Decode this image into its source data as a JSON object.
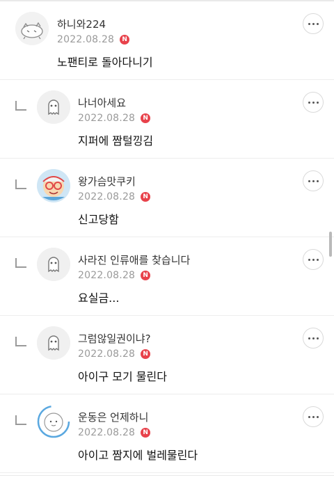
{
  "comments": [
    {
      "nickname": "하니와224",
      "date": "2022.08.28",
      "badge": "N",
      "text": "노팬티로 돌아다니기",
      "avatar": "cat-doodle-avatar",
      "is_reply": false
    },
    {
      "nickname": "나너아세요",
      "date": "2022.08.28",
      "badge": "N",
      "text": "지퍼에 짬털낑김",
      "avatar": "default-ghost-avatar",
      "is_reply": true
    },
    {
      "nickname": "왕가슴맛쿠키",
      "date": "2022.08.28",
      "badge": "N",
      "text": "신고당함",
      "avatar": "cookie-character-avatar",
      "is_reply": true
    },
    {
      "nickname": "사라진 인류애를 찾습니다",
      "date": "2022.08.28",
      "badge": "N",
      "text": "요실금...",
      "avatar": "default-ghost-avatar",
      "is_reply": true
    },
    {
      "nickname": "그럼않일권이냐?",
      "date": "2022.08.28",
      "badge": "N",
      "text": "아이구 모기 물린다",
      "avatar": "default-ghost-avatar",
      "is_reply": true
    },
    {
      "nickname": "운동은 언제하니",
      "date": "2022.08.28",
      "badge": "N",
      "text": "아이고 짬지에 벌레물린다",
      "avatar": "round-face-avatar",
      "is_reply": true
    }
  ],
  "colors": {
    "badge": "#e8424b",
    "date": "#9a9a9a",
    "divider": "#ededed"
  }
}
